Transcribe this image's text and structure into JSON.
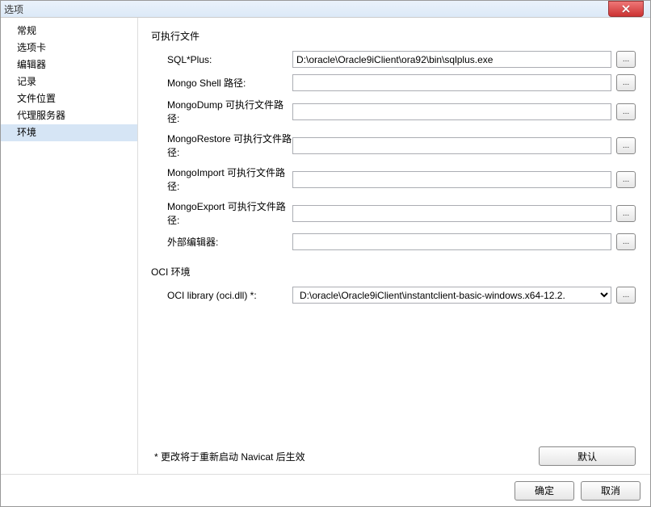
{
  "title": "选项",
  "sidebar": {
    "items": [
      {
        "label": "常规"
      },
      {
        "label": "选项卡"
      },
      {
        "label": "编辑器"
      },
      {
        "label": "记录"
      },
      {
        "label": "文件位置"
      },
      {
        "label": "代理服务器"
      },
      {
        "label": "环境"
      }
    ]
  },
  "main": {
    "section1_title": "可执行文件",
    "rows": [
      {
        "label": "SQL*Plus:",
        "value": "D:\\oracle\\Oracle9iClient\\ora92\\bin\\sqlplus.exe"
      },
      {
        "label": "Mongo Shell 路径:",
        "value": ""
      },
      {
        "label": "MongoDump 可执行文件路径:",
        "value": ""
      },
      {
        "label": "MongoRestore 可执行文件路径:",
        "value": ""
      },
      {
        "label": "MongoImport 可执行文件路径:",
        "value": ""
      },
      {
        "label": "MongoExport 可执行文件路径:",
        "value": ""
      },
      {
        "label": "外部编辑器:",
        "value": ""
      }
    ],
    "section2_title": "OCI 环境",
    "oci_label": "OCI library (oci.dll) *:",
    "oci_value": "D:\\oracle\\Oracle9iClient\\instantclient-basic-windows.x64-12.2.",
    "note": "* 更改将于重新启动 Navicat 后生效",
    "default_btn": "默认"
  },
  "footer": {
    "ok": "确定",
    "cancel": "取消"
  },
  "browse_label": "..."
}
